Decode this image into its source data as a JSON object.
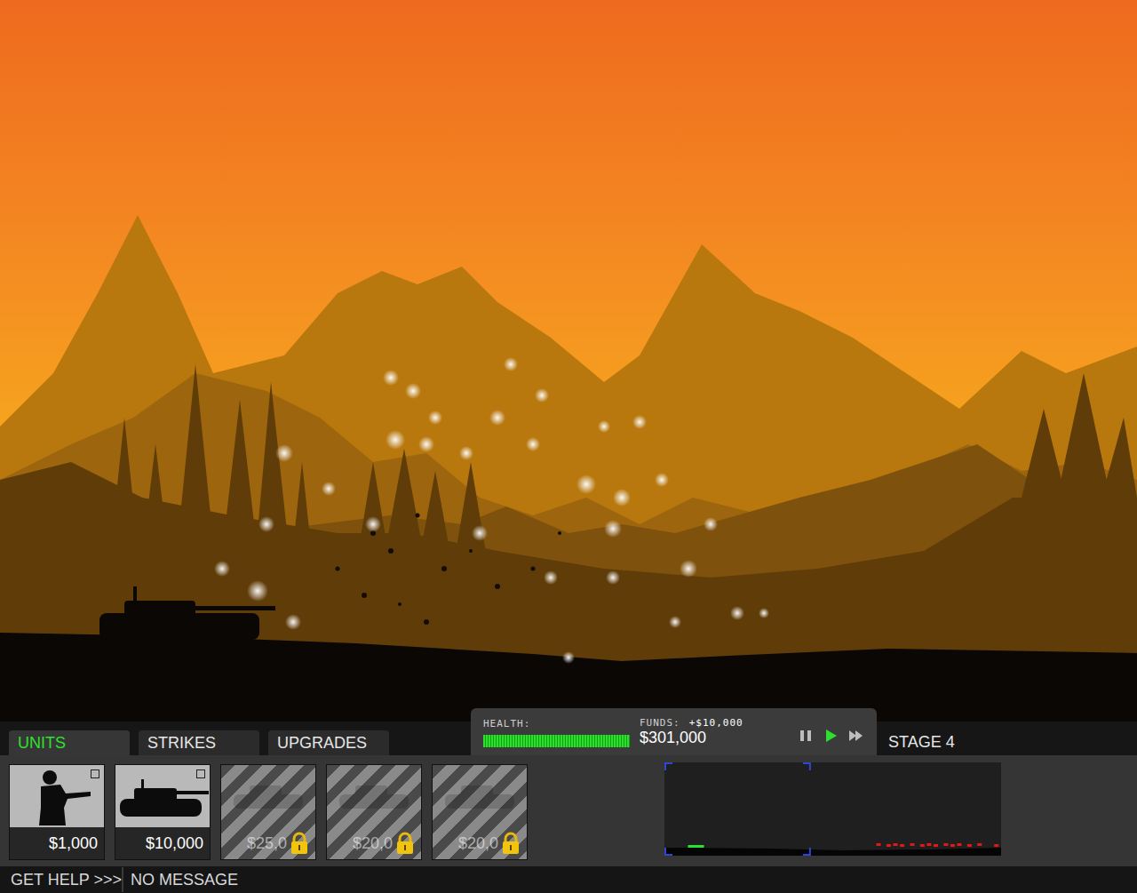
{
  "tabs": [
    {
      "label": "UNITS",
      "selected": true
    },
    {
      "label": "STRIKES",
      "selected": false
    },
    {
      "label": "UPGRADES",
      "selected": false
    }
  ],
  "status": {
    "health_label": "HEALTH:",
    "health": 1.0,
    "funds_label": "FUNDS:",
    "income": "+$10,000",
    "funds": "$301,000"
  },
  "controls": [
    {
      "kind": "pause",
      "selected": false
    },
    {
      "kind": "play",
      "selected": true
    },
    {
      "kind": "fast",
      "selected": false
    }
  ],
  "stage": "STAGE 4",
  "units": [
    {
      "price": "$1,000",
      "kind": "soldier"
    },
    {
      "price": "$10,000",
      "kind": "tank"
    },
    {
      "price": "$25,0",
      "kind": "locked"
    },
    {
      "price": "$20,0",
      "kind": "locked"
    },
    {
      "price": "$20,0",
      "kind": "locked"
    }
  ],
  "minimap": {
    "view_start": 0,
    "view_end": 0.435,
    "friendly": [
      0.07
    ],
    "enemy": [
      0.64,
      0.67,
      0.69,
      0.71,
      0.74,
      0.77,
      0.79,
      0.81,
      0.84,
      0.86,
      0.88,
      0.91,
      0.94,
      0.99
    ]
  },
  "help": "GET HELP >>>",
  "message": "NO MESSAGE"
}
